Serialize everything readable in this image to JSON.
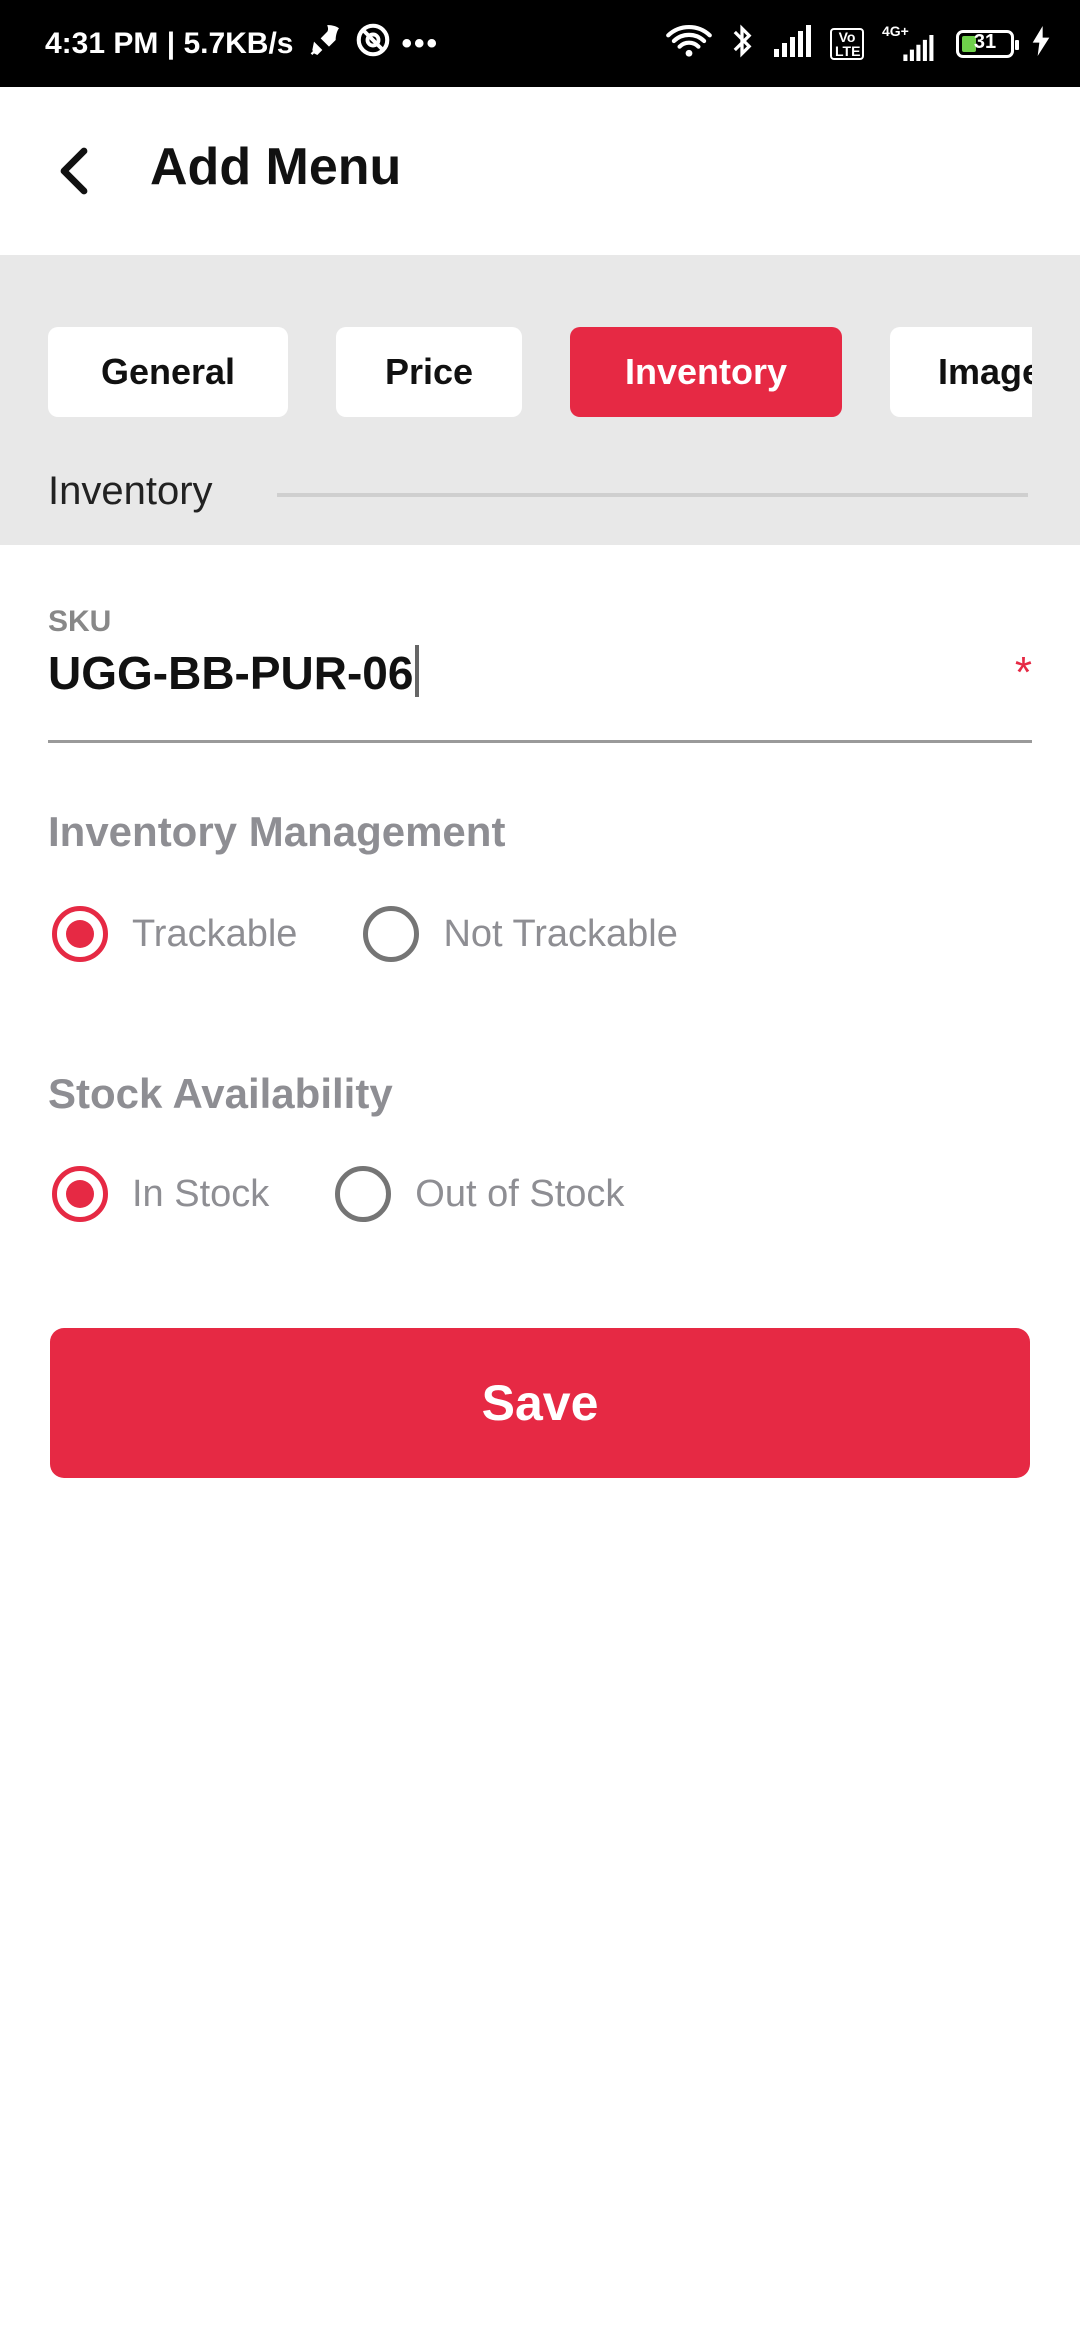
{
  "status_bar": {
    "time_speed": "4:31 PM | 5.7KB/s",
    "network_badge": "4G+",
    "volte_badge": "Vo LTE",
    "battery": "31"
  },
  "header": {
    "title": "Add Menu"
  },
  "tabs": [
    {
      "label": "General",
      "active": false
    },
    {
      "label": "Price",
      "active": false
    },
    {
      "label": "Inventory",
      "active": true
    },
    {
      "label": "Image",
      "active": false
    }
  ],
  "section": {
    "label": "Inventory"
  },
  "sku": {
    "label": "SKU",
    "value": "UGG-BB-PUR-06",
    "required_mark": "*"
  },
  "inventory_management": {
    "title": "Inventory Management",
    "options": [
      {
        "label": "Trackable",
        "selected": true
      },
      {
        "label": "Not Trackable",
        "selected": false
      }
    ]
  },
  "stock_availability": {
    "title": "Stock Availability",
    "options": [
      {
        "label": "In Stock",
        "selected": true
      },
      {
        "label": "Out of Stock",
        "selected": false
      }
    ]
  },
  "actions": {
    "save_label": "Save"
  },
  "colors": {
    "accent": "#e62944",
    "muted_text": "#8e8e93",
    "tab_background": "#e8e8e8"
  }
}
